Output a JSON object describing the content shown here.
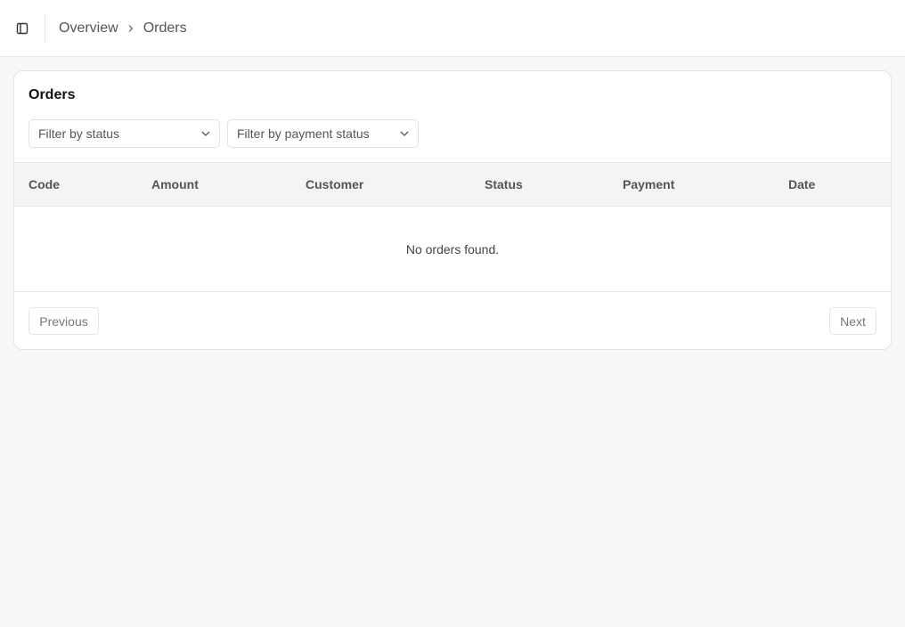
{
  "header": {
    "sidebar_toggle_icon": "sidebar-toggle-icon",
    "breadcrumb": [
      "Overview",
      "Orders"
    ],
    "breadcrumb_separator_icon": "chevron-right-icon"
  },
  "orders_card": {
    "title": "Orders",
    "filters": {
      "status_placeholder": "Filter by status",
      "payment_placeholder": "Filter by payment status",
      "dropdown_icon": "chevron-down-icon"
    },
    "table": {
      "columns": [
        "Code",
        "Amount",
        "Customer",
        "Status",
        "Payment",
        "Date"
      ],
      "empty_message": "No orders found."
    },
    "pagination": {
      "previous_label": "Previous",
      "next_label": "Next"
    }
  },
  "colors": {
    "page_background": "#f7f7f7",
    "card_background": "#ffffff",
    "border": "#e3e3e3",
    "table_header_background": "#f4f4f4"
  }
}
